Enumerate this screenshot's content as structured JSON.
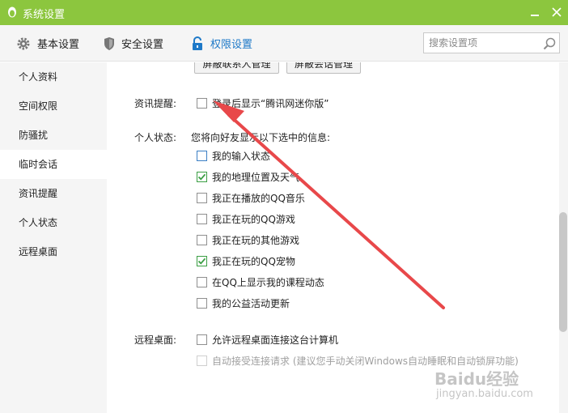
{
  "window": {
    "title": "系统设置",
    "icon": "qq-penguin-icon",
    "accent": "#8cc63e"
  },
  "topnav": {
    "tabs": [
      {
        "label": "基本设置",
        "icon": "gear-icon"
      },
      {
        "label": "安全设置",
        "icon": "shield-icon"
      },
      {
        "label": "权限设置",
        "icon": "lock-icon"
      }
    ],
    "active_tab": "权限设置",
    "search_placeholder": "搜索设置项"
  },
  "sidebar": {
    "items": [
      {
        "label": "个人资料"
      },
      {
        "label": "空间权限"
      },
      {
        "label": "防骚扰"
      },
      {
        "label": "临时会话"
      },
      {
        "label": "资讯提醒"
      },
      {
        "label": "个人状态"
      },
      {
        "label": "远程桌面"
      }
    ],
    "active_item": "临时会话"
  },
  "main": {
    "buttons": {
      "contact": "屏蔽联系人管理",
      "session": "屏蔽会话管理"
    },
    "news": {
      "label": "资讯提醒:",
      "option": {
        "label": "登录后显示“腾讯网迷你版”",
        "checked": false
      }
    },
    "status": {
      "label": "个人状态:",
      "description": "您将向好友显示以下选中的信息:",
      "options": [
        {
          "label": "我的输入状态",
          "checked": false
        },
        {
          "label": "我的地理位置及天气",
          "checked": true
        },
        {
          "label": "我正在播放的QQ音乐",
          "checked": false
        },
        {
          "label": "我正在玩的QQ游戏",
          "checked": false
        },
        {
          "label": "我正在玩的其他游戏",
          "checked": false
        },
        {
          "label": "我正在玩的QQ宠物",
          "checked": true
        },
        {
          "label": "在QQ上显示我的课程动态",
          "checked": false
        },
        {
          "label": "我的公益活动更新",
          "checked": false
        }
      ]
    },
    "remote": {
      "label": "远程桌面:",
      "options": [
        {
          "label": "允许远程桌面连接这台计算机",
          "checked": false,
          "enabled": true
        },
        {
          "label": "自动接受连接请求 (建议您手动关闭Windows自动睡眠和自动锁屏功能)",
          "checked": false,
          "enabled": false
        }
      ]
    }
  },
  "annotation": {
    "color": "#e8484a"
  },
  "watermark": {
    "text": "Baidu经验",
    "sub": "jingyan.baidu.com"
  }
}
